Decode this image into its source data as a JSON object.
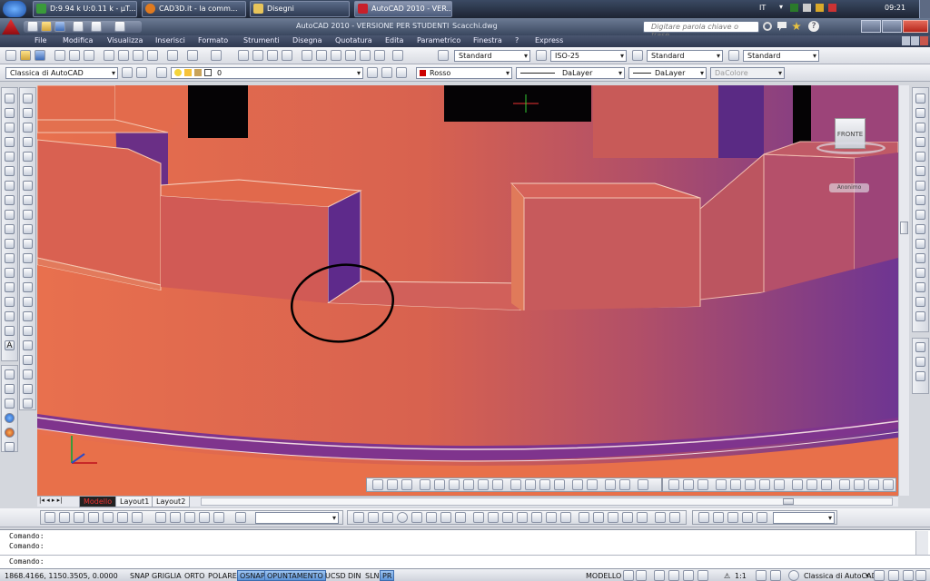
{
  "taskbar": {
    "apps": [
      {
        "label": "D:9.94 k U:0.11 k - µT...",
        "active": false
      },
      {
        "label": "CAD3D.it - la comm...",
        "active": false
      },
      {
        "label": "Disegni",
        "active": false
      },
      {
        "label": "AutoCAD 2010 - VER...",
        "active": true
      }
    ],
    "language": "IT",
    "clock": "09:21"
  },
  "titlebar": {
    "title": "AutoCAD 2010 - VERSIONE PER STUDENTI",
    "document": "Scacchi.dwg",
    "search_placeholder": "Digitare parola chiave o frase"
  },
  "menu": [
    "File",
    "Modifica",
    "Visualizza",
    "Inserisci",
    "Formato",
    "Strumenti",
    "Disegna",
    "Quotatura",
    "Edita",
    "Parametrico",
    "Finestra",
    "?",
    "Express"
  ],
  "toolbar2": {
    "text_style": "Standard",
    "dim_style": "ISO-25",
    "table_style": "Standard",
    "multileader_style": "Standard"
  },
  "toolbar3": {
    "workspace": "Classica di AutoCAD",
    "layer": "0",
    "color": "Rosso",
    "linetype": "DaLayer",
    "lineweight": "DaLayer",
    "plotstyle": "DaColore"
  },
  "viewcube": {
    "face": "FRONTE",
    "ucs": "Anonimo"
  },
  "layout_tabs": [
    "Modello",
    "Layout1",
    "Layout2"
  ],
  "command": {
    "lines": [
      "Comando:",
      "Comando:",
      "Comando:"
    ]
  },
  "status": {
    "coords": "1868.4166, 1150.3505, 0.0000",
    "toggles": [
      {
        "label": "SNAP",
        "on": false
      },
      {
        "label": "GRIGLIA",
        "on": false
      },
      {
        "label": "ORTO",
        "on": false
      },
      {
        "label": "POLARE",
        "on": false
      },
      {
        "label": "OSNAP",
        "on": true
      },
      {
        "label": "OPUNTAMENTO",
        "on": true
      },
      {
        "label": "UCSD",
        "on": false
      },
      {
        "label": "DIN",
        "on": false
      },
      {
        "label": "SLN",
        "on": false
      },
      {
        "label": "PR",
        "on": true
      }
    ],
    "space": "MODELLO",
    "scale": "1:1",
    "workspace": "Classica di AutoCAD"
  },
  "colors": {
    "layer_color": "#cc0000",
    "annotation_circle": "#000000"
  }
}
